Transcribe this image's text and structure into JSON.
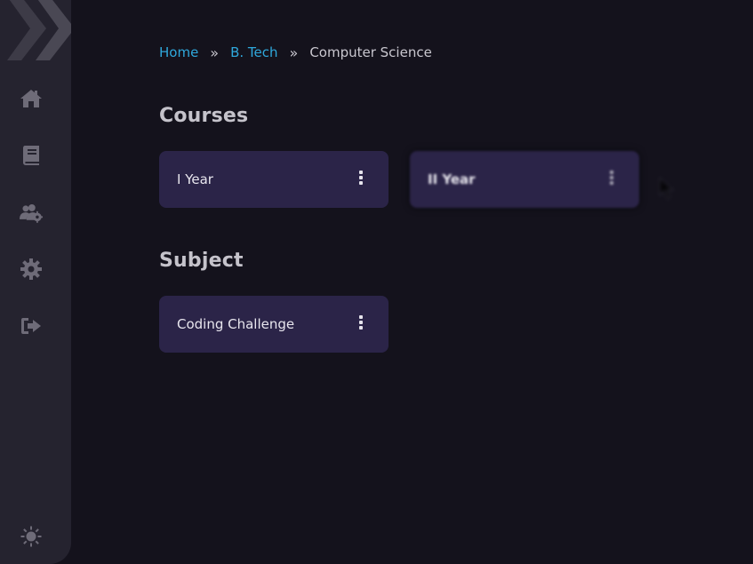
{
  "sidebar": {
    "items": [
      {
        "icon": "home-icon"
      },
      {
        "icon": "book-icon"
      },
      {
        "icon": "users-gear-icon"
      },
      {
        "icon": "gear-icon"
      },
      {
        "icon": "sign-out-icon"
      }
    ],
    "bottom_icon": "sun-icon",
    "logo": "chevrons-logo"
  },
  "breadcrumb": {
    "home": "Home",
    "separator": "»",
    "program": "B. Tech",
    "current": "Computer Science"
  },
  "courses": {
    "title": "Courses",
    "items": [
      {
        "label": "I Year"
      },
      {
        "label": "II Year"
      }
    ]
  },
  "subjects": {
    "title": "Subject",
    "items": [
      {
        "label": "Coding Challenge"
      }
    ]
  },
  "colors": {
    "background": "#14121c",
    "sidebar": "#25232f",
    "card": "#2b2448",
    "link": "#2fa8dc"
  }
}
